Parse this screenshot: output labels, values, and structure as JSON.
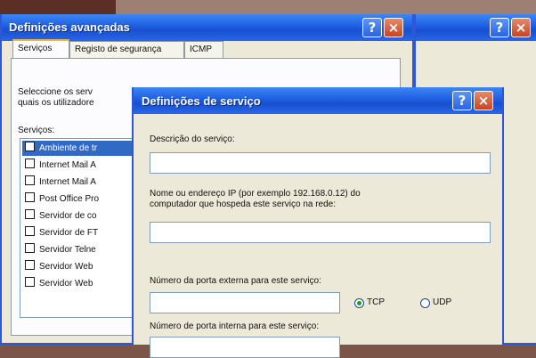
{
  "back_window": {
    "help_glyph": "?",
    "close_glyph": "×"
  },
  "advanced": {
    "title": "Definições avançadas",
    "help_glyph": "?",
    "close_glyph": "×",
    "tabs": [
      {
        "label": "Serviços",
        "selected": true
      },
      {
        "label": "Registo de segurança",
        "selected": false
      },
      {
        "label": "ICMP",
        "selected": false
      }
    ],
    "description": "Seleccione os serv\nquais os utilizadore",
    "services_label": "Serviços:",
    "services": [
      {
        "label": "Ambiente de tr",
        "selected": true
      },
      {
        "label": "Internet Mail A",
        "selected": false
      },
      {
        "label": "Internet Mail A",
        "selected": false
      },
      {
        "label": "Post Office Pro",
        "selected": false
      },
      {
        "label": "Servidor de co",
        "selected": false
      },
      {
        "label": "Servidor de FT",
        "selected": false
      },
      {
        "label": "Servidor Telne",
        "selected": false
      },
      {
        "label": "Servidor Web",
        "selected": false
      },
      {
        "label": "Servidor Web",
        "selected": false
      }
    ]
  },
  "service_dialog": {
    "title": "Definições de serviço",
    "help_glyph": "?",
    "close_glyph": "×",
    "description_label": "Descrição do serviço:",
    "description_value": "",
    "host_label": "Nome ou endereço IP (por exemplo 192.168.0.12) do\ncomputador que hospeda este serviço na rede:",
    "host_value": "",
    "external_port_label": "Número da porta externa para este serviço:",
    "external_port_value": "",
    "protocol_tcp": "TCP",
    "protocol_udp": "UDP",
    "protocol_selected": "TCP",
    "internal_port_label": "Número de porta interna para este serviço:",
    "internal_port_value": ""
  },
  "colors": {
    "titlebar": "#1e5ee0",
    "dialog_face": "#ece9d8",
    "selection": "#316ac5"
  }
}
